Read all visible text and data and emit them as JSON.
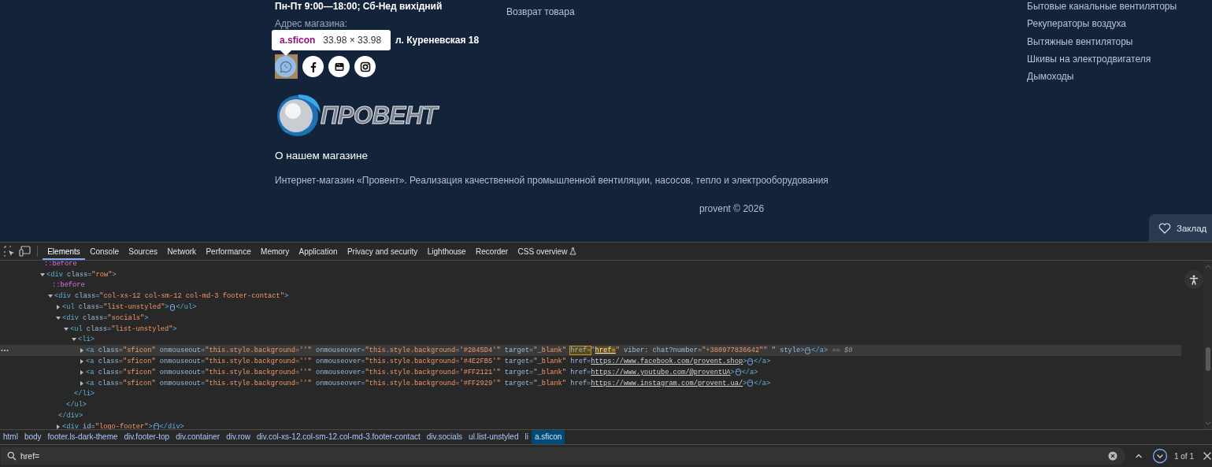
{
  "footer": {
    "hours": "Пн-Пт 9:00—18:00; Сб-Нед вихідний",
    "address_label": "Адрес магазина:",
    "address": "л. Куреневская 18",
    "socials": [
      {
        "kind": "whatsapp",
        "highlighted": true
      },
      {
        "kind": "facebook",
        "highlighted": false
      },
      {
        "kind": "youtube",
        "highlighted": false
      },
      {
        "kind": "instagram",
        "highlighted": false
      }
    ],
    "logo_text": "ПРОВЕНТ",
    "middle_links": [
      "Возврат товара"
    ],
    "right_links": [
      "Бытовые канальные вентиляторы",
      "Рекуператоры воздуха",
      "Вытяжные вентиляторы",
      "Шкивы на электродвигателя",
      "Дымоходы"
    ],
    "about_title": "О нашем магазине",
    "about_text": "Интернет-магазин «Провент». Реализация качественной промышленной вентиляции, насосов, тепло и электрооборудования",
    "copyright": "provent © 2026",
    "bookmark": "Заклад"
  },
  "tooltip": {
    "selector": "a.sficon",
    "size": "33.98 × 33.98"
  },
  "devtools": {
    "tabs": [
      {
        "label": "Elements",
        "selected": true,
        "experimental": false
      },
      {
        "label": "Console",
        "selected": false,
        "experimental": false
      },
      {
        "label": "Sources",
        "selected": false,
        "experimental": false
      },
      {
        "label": "Network",
        "selected": false,
        "experimental": false
      },
      {
        "label": "Performance",
        "selected": false,
        "experimental": false
      },
      {
        "label": "Memory",
        "selected": false,
        "experimental": false
      },
      {
        "label": "Application",
        "selected": false,
        "experimental": false
      },
      {
        "label": "Privacy and security",
        "selected": false,
        "experimental": false
      },
      {
        "label": "Lighthouse",
        "selected": false,
        "experimental": false
      },
      {
        "label": "Recorder",
        "selected": false,
        "experimental": false
      },
      {
        "label": "CSS overview",
        "selected": false,
        "experimental": true
      }
    ],
    "dom": [
      {
        "selected": false,
        "parts": [
          {
            "kind": "pseudo",
            "text": "::before"
          }
        ]
      },
      {
        "selected": false,
        "expanded": true,
        "parts": [
          {
            "kind": "tag",
            "text": "<div"
          },
          {
            "kind": "attr",
            "text": " class="
          },
          {
            "kind": "val",
            "text": "\"row\""
          },
          {
            "kind": "tag",
            "text": ">"
          }
        ],
        "children": [
          {
            "selected": false,
            "parts": [
              {
                "kind": "pseudo",
                "text": "::before"
              }
            ]
          },
          {
            "selected": false,
            "expanded": true,
            "parts": [
              {
                "kind": "tag",
                "text": "<div"
              },
              {
                "kind": "attr",
                "text": " class="
              },
              {
                "kind": "val",
                "text": "\"col-xs-12 col-sm-12 col-md-3 footer-contact\""
              },
              {
                "kind": "tag",
                "text": ">"
              }
            ],
            "children": [
              {
                "selected": false,
                "expanded": false,
                "parts": [
                  {
                    "kind": "tag",
                    "text": "<ul"
                  },
                  {
                    "kind": "attr",
                    "text": " class="
                  },
                  {
                    "kind": "val",
                    "text": "\"list-unstyled\""
                  },
                  {
                    "kind": "tag",
                    "text": ">"
                  },
                  {
                    "kind": "more",
                    "text": "⋯"
                  },
                  {
                    "kind": "tag",
                    "text": "</ul>"
                  }
                ]
              },
              {
                "selected": false,
                "expanded": true,
                "parts": [
                  {
                    "kind": "tag",
                    "text": "<div"
                  },
                  {
                    "kind": "attr",
                    "text": " class="
                  },
                  {
                    "kind": "val",
                    "text": "\"socials\""
                  },
                  {
                    "kind": "tag",
                    "text": ">"
                  }
                ],
                "close": [
                  {
                    "kind": "tag",
                    "text": "</div>"
                  }
                ],
                "children": [
                  {
                    "selected": false,
                    "expanded": true,
                    "parts": [
                      {
                        "kind": "tag",
                        "text": "<ul"
                      },
                      {
                        "kind": "attr",
                        "text": " class="
                      },
                      {
                        "kind": "val",
                        "text": "\"list-unstyled\""
                      },
                      {
                        "kind": "tag",
                        "text": ">"
                      }
                    ],
                    "close": [
                      {
                        "kind": "tag",
                        "text": "</ul>"
                      }
                    ],
                    "children": [
                      {
                        "selected": false,
                        "expanded": true,
                        "parts": [
                          {
                            "kind": "tag",
                            "text": "<li>"
                          }
                        ],
                        "close": [
                          {
                            "kind": "tag",
                            "text": "</li>"
                          }
                        ],
                        "children": [
                          {
                            "selected": true,
                            "expanded": false,
                            "parts": [
                              {
                                "kind": "tag",
                                "text": "<a"
                              },
                              {
                                "kind": "attr",
                                "text": " class="
                              },
                              {
                                "kind": "val",
                                "text": "\"sficon\""
                              },
                              {
                                "kind": "attr",
                                "text": " onmouseout="
                              },
                              {
                                "kind": "val",
                                "text": "\"this.style.background=''\""
                              },
                              {
                                "kind": "attr",
                                "text": " onmouseover="
                              },
                              {
                                "kind": "val",
                                "text": "\"this.style.background='#2845D4'\""
                              },
                              {
                                "kind": "attr",
                                "text": " target="
                              },
                              {
                                "kind": "val",
                                "text": "\"_blank\" "
                              },
                              {
                                "kind": "match",
                                "text": "href="
                              },
                              {
                                "kind": "val",
                                "text": "\""
                              },
                              {
                                "kind": "linkmatch",
                                "text": "href="
                              },
                              {
                                "kind": "val",
                                "text": "\""
                              },
                              {
                                "kind": "attr",
                                "text": " viber: chat?number="
                              },
                              {
                                "kind": "val",
                                "text": "\"+380977836642\"\""
                              },
                              {
                                "kind": "attr",
                                "text": " \" style"
                              },
                              {
                                "kind": "tag",
                                "text": ">"
                              },
                              {
                                "kind": "more",
                                "text": "⋯"
                              },
                              {
                                "kind": "tag",
                                "text": "</a>"
                              },
                              {
                                "kind": "note",
                                "text": " == $0"
                              }
                            ]
                          },
                          {
                            "selected": false,
                            "expanded": false,
                            "parts": [
                              {
                                "kind": "tag",
                                "text": "<a"
                              },
                              {
                                "kind": "attr",
                                "text": " class="
                              },
                              {
                                "kind": "val",
                                "text": "\"sficon\""
                              },
                              {
                                "kind": "attr",
                                "text": " onmouseout="
                              },
                              {
                                "kind": "val",
                                "text": "\"this.style.background=''\""
                              },
                              {
                                "kind": "attr",
                                "text": " onmouseover="
                              },
                              {
                                "kind": "val",
                                "text": "\"this.style.background='#4E2FB5'\""
                              },
                              {
                                "kind": "attr",
                                "text": " target="
                              },
                              {
                                "kind": "val",
                                "text": "\"_blank\""
                              },
                              {
                                "kind": "attr",
                                "text": " href="
                              },
                              {
                                "kind": "link",
                                "text": "https://www.facebook.com/provent.shop"
                              },
                              {
                                "kind": "tag",
                                "text": ">"
                              },
                              {
                                "kind": "more",
                                "text": "⋯"
                              },
                              {
                                "kind": "tag",
                                "text": "</a>"
                              }
                            ]
                          },
                          {
                            "selected": false,
                            "expanded": false,
                            "parts": [
                              {
                                "kind": "tag",
                                "text": "<a"
                              },
                              {
                                "kind": "attr",
                                "text": " class="
                              },
                              {
                                "kind": "val",
                                "text": "\"sficon\""
                              },
                              {
                                "kind": "attr",
                                "text": " onmouseout="
                              },
                              {
                                "kind": "val",
                                "text": "\"this.style.background=''\""
                              },
                              {
                                "kind": "attr",
                                "text": " onmouseover="
                              },
                              {
                                "kind": "val",
                                "text": "\"this.style.background='#FF2121'\""
                              },
                              {
                                "kind": "attr",
                                "text": " target="
                              },
                              {
                                "kind": "val",
                                "text": "\"_blank\""
                              },
                              {
                                "kind": "attr",
                                "text": " href="
                              },
                              {
                                "kind": "link",
                                "text": "https://www.youtube.com/@proventUA"
                              },
                              {
                                "kind": "tag",
                                "text": ">"
                              },
                              {
                                "kind": "more",
                                "text": "⋯"
                              },
                              {
                                "kind": "tag",
                                "text": "</a>"
                              }
                            ]
                          },
                          {
                            "selected": false,
                            "expanded": false,
                            "parts": [
                              {
                                "kind": "tag",
                                "text": "<a"
                              },
                              {
                                "kind": "attr",
                                "text": " class="
                              },
                              {
                                "kind": "val",
                                "text": "\"sficon\""
                              },
                              {
                                "kind": "attr",
                                "text": " onmouseout="
                              },
                              {
                                "kind": "val",
                                "text": "\"this.style.background=''\""
                              },
                              {
                                "kind": "attr",
                                "text": " onmouseover="
                              },
                              {
                                "kind": "val",
                                "text": "\"this.style.background='#FF2929'\""
                              },
                              {
                                "kind": "attr",
                                "text": " target="
                              },
                              {
                                "kind": "val",
                                "text": "\"_blank\""
                              },
                              {
                                "kind": "attr",
                                "text": " href="
                              },
                              {
                                "kind": "link",
                                "text": "https://www.instagram.com/provent.ua/"
                              },
                              {
                                "kind": "tag",
                                "text": ">"
                              },
                              {
                                "kind": "more",
                                "text": "⋯"
                              },
                              {
                                "kind": "tag",
                                "text": "</a>"
                              }
                            ]
                          }
                        ]
                      }
                    ]
                  }
                ]
              },
              {
                "selected": false,
                "expanded": false,
                "parts": [
                  {
                    "kind": "tag",
                    "text": "<div"
                  },
                  {
                    "kind": "attr",
                    "text": " id="
                  },
                  {
                    "kind": "val",
                    "text": "\"logo-footer\""
                  },
                  {
                    "kind": "tag",
                    "text": ">"
                  },
                  {
                    "kind": "more",
                    "text": "⋯"
                  },
                  {
                    "kind": "tag",
                    "text": "</div>"
                  }
                ]
              }
            ]
          }
        ]
      }
    ],
    "breadcrumbs": [
      {
        "label": "html",
        "selected": false
      },
      {
        "label": "body",
        "selected": false
      },
      {
        "label": "footer.ls-dark-theme",
        "selected": false
      },
      {
        "label": "div.footer-top",
        "selected": false
      },
      {
        "label": "div.container",
        "selected": false
      },
      {
        "label": "div.row",
        "selected": false
      },
      {
        "label": "div.col-xs-12.col-sm-12.col-md-3.footer-contact",
        "selected": false
      },
      {
        "label": "div.socials",
        "selected": false
      },
      {
        "label": "ul.list-unstyled",
        "selected": false
      },
      {
        "label": "li",
        "selected": false
      },
      {
        "label": "a.sficon",
        "selected": true
      }
    ],
    "search": {
      "value": "href=",
      "matches": "1 of 1"
    }
  }
}
